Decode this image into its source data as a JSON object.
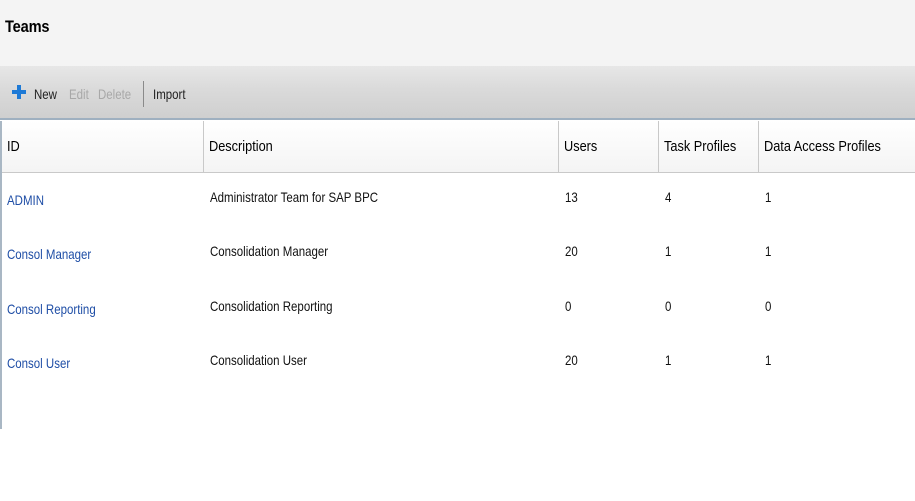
{
  "page": {
    "title": "Teams"
  },
  "toolbar": {
    "new_label": "New",
    "edit_label": "Edit",
    "delete_label": "Delete",
    "import_label": "Import",
    "new_icon": "plus-icon",
    "accent_color": "#1e7ad6"
  },
  "table": {
    "columns": [
      "ID",
      "Description",
      "Users",
      "Task Profiles",
      "Data Access Profiles"
    ],
    "rows": [
      {
        "id": "ADMIN",
        "description": "Administrator Team for SAP BPC",
        "users": "13",
        "task_profiles": "4",
        "data_access_profiles": "1"
      },
      {
        "id": "Consol Manager",
        "description": "Consolidation Manager",
        "users": "20",
        "task_profiles": "1",
        "data_access_profiles": "1"
      },
      {
        "id": "Consol Reporting",
        "description": "Consolidation Reporting",
        "users": "0",
        "task_profiles": "0",
        "data_access_profiles": "0"
      },
      {
        "id": "Consol User",
        "description": "Consolidation User",
        "users": "20",
        "task_profiles": "1",
        "data_access_profiles": "1"
      }
    ]
  }
}
